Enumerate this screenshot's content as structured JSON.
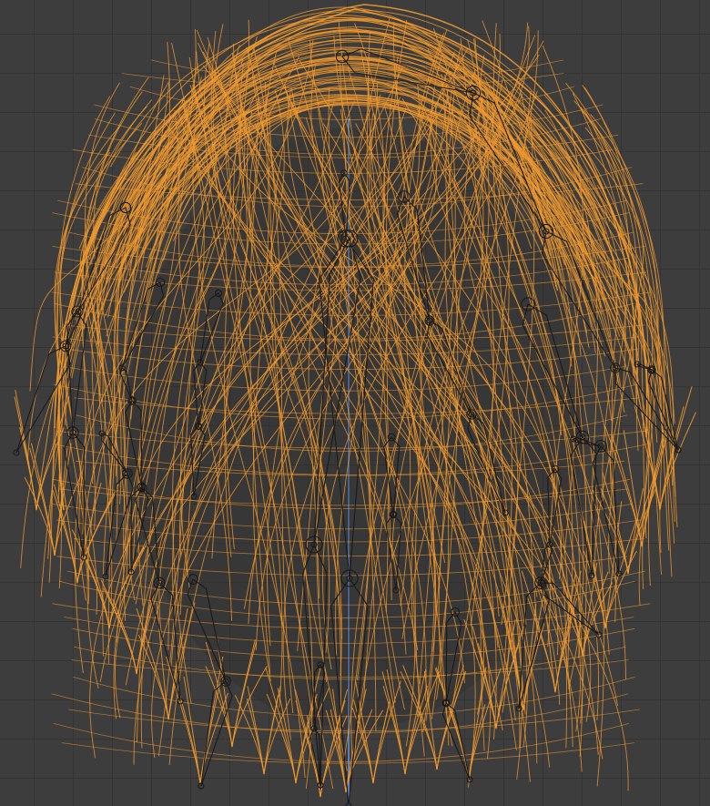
{
  "viewport": {
    "name": "3D Viewport",
    "background_color": "#3d3d3d",
    "grid_color": "#343434",
    "axis_color": "#5680c2"
  },
  "object": {
    "type": "hair mesh wireframe",
    "state": "selected",
    "wire_color": "#f29a2e"
  },
  "armature": {
    "type": "armature bones (octahedral, wire)",
    "bone_color": "#1a1a1a"
  }
}
